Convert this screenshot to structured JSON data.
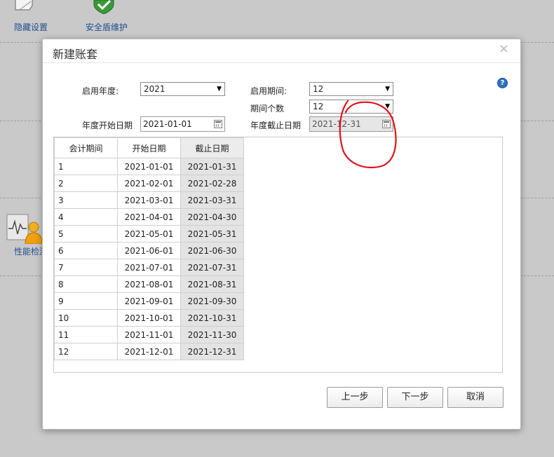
{
  "background": {
    "icons": [
      {
        "label": "隐藏设置",
        "icon": "page-icon"
      },
      {
        "label": "安全盾维护",
        "icon": "shield-check-icon"
      },
      {
        "label": "性能检测",
        "icon": "performance-user-icon"
      }
    ]
  },
  "dialog": {
    "title": "新建账套",
    "close_symbol": "×",
    "help_symbol": "?",
    "form": {
      "start_year_label": "启用年度:",
      "start_year_value": "2021",
      "start_period_label": "启用期间:",
      "start_period_value": "12",
      "period_count_label": "期间个数",
      "period_count_value": "12",
      "year_start_label": "年度开始日期",
      "year_start_value": "2021-01-01",
      "year_end_label": "年度截止日期",
      "year_end_value": "2021-12-31"
    },
    "table": {
      "headers": [
        "会计期间",
        "开始日期",
        "截止日期"
      ],
      "rows": [
        [
          "1",
          "2021-01-01",
          "2021-01-31"
        ],
        [
          "2",
          "2021-02-01",
          "2021-02-28"
        ],
        [
          "3",
          "2021-03-01",
          "2021-03-31"
        ],
        [
          "4",
          "2021-04-01",
          "2021-04-30"
        ],
        [
          "5",
          "2021-05-01",
          "2021-05-31"
        ],
        [
          "6",
          "2021-06-01",
          "2021-06-30"
        ],
        [
          "7",
          "2021-07-01",
          "2021-07-31"
        ],
        [
          "8",
          "2021-08-01",
          "2021-08-31"
        ],
        [
          "9",
          "2021-09-01",
          "2021-09-30"
        ],
        [
          "10",
          "2021-10-01",
          "2021-10-31"
        ],
        [
          "11",
          "2021-11-01",
          "2021-11-30"
        ],
        [
          "12",
          "2021-12-01",
          "2021-12-31"
        ]
      ]
    },
    "buttons": {
      "prev": "上一步",
      "next": "下一步",
      "cancel": "取消"
    }
  },
  "colors": {
    "annotation": "#e0141a",
    "link_text": "#1f4f8f",
    "readonly_cell": "#e3e3e3"
  }
}
